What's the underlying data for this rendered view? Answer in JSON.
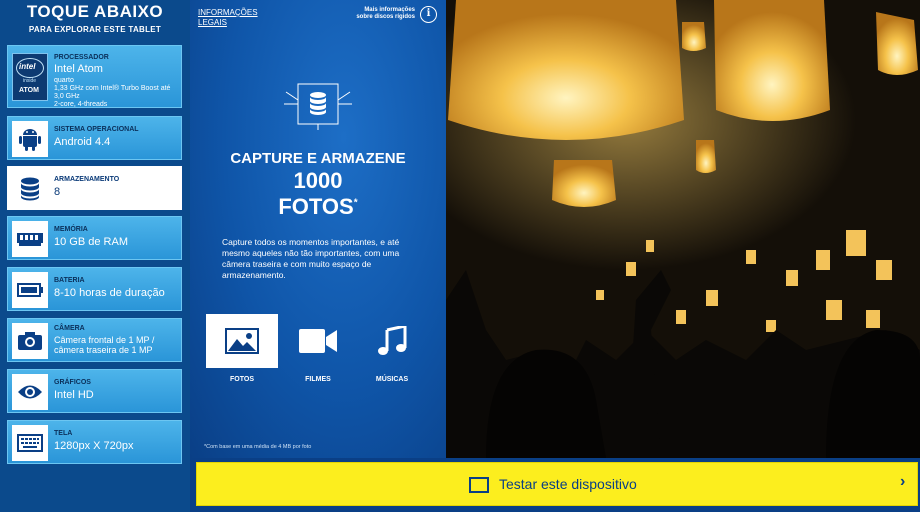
{
  "sidebar": {
    "title": "TOQUE ABAIXO",
    "subtitle": "PARA EXPLORAR ESTE TABLET",
    "processor": {
      "label": "PROCESSADOR",
      "value": "Intel Atom",
      "detail1": "quarto",
      "detail2": "1,33 GHz com Intel® Turbo Boost até",
      "detail3": "3,0 GHz",
      "detail4": "2-core, 4-threads",
      "logo_top": "intel",
      "logo_mid": "inside",
      "logo_bottom": "ATOM"
    },
    "items": [
      {
        "label": "SISTEMA OPERACIONAL",
        "value": "Android 4.4",
        "icon": "android-icon"
      },
      {
        "label": "ARMAZENAMENTO",
        "value": "8",
        "icon": "database-icon"
      },
      {
        "label": "MEMÓRIA",
        "value": "10 GB de RAM",
        "icon": "memory-chip-icon"
      },
      {
        "label": "BATERIA",
        "value": "8-10 horas de duração",
        "icon": "battery-icon"
      },
      {
        "label": "CÂMERA",
        "value": "Câmera frontal de 1 MP /",
        "value2": "câmera traseira de 1 MP",
        "icon": "camera-icon"
      },
      {
        "label": "GRÁFICOS",
        "value": "Intel HD",
        "icon": "eye-icon"
      },
      {
        "label": "TELA",
        "value": "1280px X 720px",
        "icon": "keyboard-screen-icon"
      }
    ]
  },
  "center": {
    "legal_line1": "INFORMAÇÕES",
    "legal_line2": "LEGAIS",
    "disk_info_line1": "Mais informações",
    "disk_info_line2": "sobre discos rígidos",
    "info_symbol": "i",
    "headline1": "CAPTURE E ARMAZENE",
    "headline2": "1000",
    "headline3": "FOTOS",
    "headline_mark": "*",
    "description": "Capture todos os momentos importantes, e até mesmo aqueles não tão importantes, com uma câmera traseira e com muito espaço de armazenamento.",
    "media": [
      {
        "label": "FOTOS",
        "icon": "image-icon",
        "active": true
      },
      {
        "label": "FILMES",
        "icon": "video-camera-icon",
        "active": false
      },
      {
        "label": "MÚSICAS",
        "icon": "music-note-icon",
        "active": false
      }
    ],
    "footnote": "*Com base em uma média de 4 MB por foto"
  },
  "bottom": {
    "test_label": "Testar este dispositivo",
    "chevron": "›"
  },
  "colors": {
    "accent_yellow": "#fcee1e",
    "dark_blue": "#0a3f86",
    "light_blue": "#2a95d8"
  }
}
